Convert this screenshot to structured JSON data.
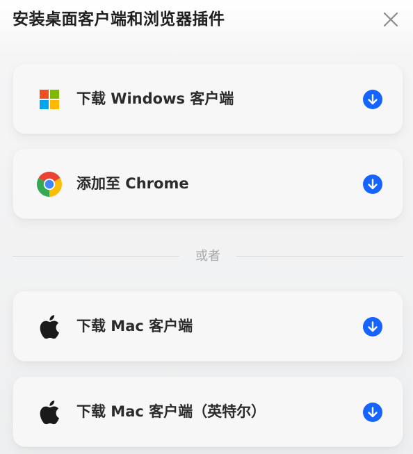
{
  "dialog": {
    "title": "安装桌面客户端和浏览器插件",
    "close_icon": "close-icon"
  },
  "options": [
    {
      "id": "windows",
      "label": "下载 Windows 客户端",
      "icon": "windows-logo-icon",
      "action_icon": "download-icon"
    },
    {
      "id": "chrome",
      "label": "添加至 Chrome",
      "icon": "chrome-logo-icon",
      "action_icon": "download-icon"
    },
    {
      "id": "mac",
      "label": "下载 Mac 客户端",
      "icon": "apple-logo-icon",
      "action_icon": "download-icon"
    },
    {
      "id": "mac-intel",
      "label": "下载 Mac 客户端（英特尔）",
      "icon": "apple-logo-icon",
      "action_icon": "download-icon"
    }
  ],
  "divider": {
    "text": "或者"
  },
  "colors": {
    "accent": "#1664ff",
    "card_bg": "#f7f7f8",
    "divider": "#d8d8da",
    "muted_text": "#a8a8ab"
  }
}
